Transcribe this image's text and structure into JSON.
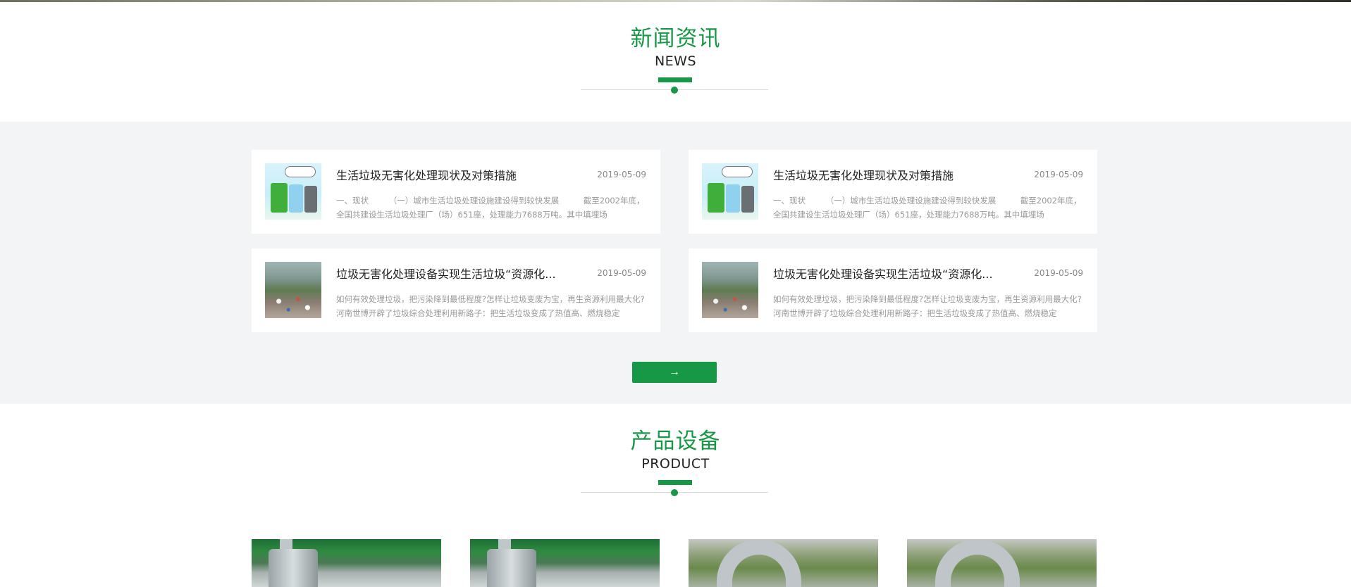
{
  "colors": {
    "accent": "#169847",
    "band_bg": "#f3f4f6"
  },
  "news_section": {
    "title_cn": "新闻资讯",
    "title_en": "NEWS",
    "items": [
      {
        "title": "生活垃圾无害化处理现状及对策措施",
        "date": "2019-05-09",
        "excerpt": "一、现状　　　（一）城市生活垃圾处理设施建设得到较快发展　　　截至2002年底，全国共建设生活垃圾处理厂（场）651座，处理能力7688万吨。其中填埋场",
        "thumb": "garbage-bins-cartoon"
      },
      {
        "title": "生活垃圾无害化处理现状及对策措施",
        "date": "2019-05-09",
        "excerpt": "一、现状　　　（一）城市生活垃圾处理设施建设得到较快发展　　　截至2002年底，全国共建设生活垃圾处理厂（场）651座，处理能力7688万吨。其中填埋场",
        "thumb": "garbage-bins-cartoon"
      },
      {
        "title": "垃圾无害化处理设备实现生活垃圾“资源化...",
        "date": "2019-05-09",
        "excerpt": "如何有效处理垃圾，把污染降到最低程度?怎样让垃圾变废为宝，再生资源利用最大化?河南世博开辟了垃圾综合处理利用新路子：把生活垃圾变成了热值高、燃烧稳定",
        "thumb": "garbage-dump-photo"
      },
      {
        "title": "垃圾无害化处理设备实现生活垃圾“资源化...",
        "date": "2019-05-09",
        "excerpt": "如何有效处理垃圾，把污染降到最低程度?怎样让垃圾变废为宝，再生资源利用最大化?河南世博开辟了垃圾综合处理利用新路子：把生活垃圾变成了热值高、燃烧稳定",
        "thumb": "garbage-dump-photo"
      }
    ],
    "more_button_label": "→"
  },
  "product_section": {
    "title_cn": "产品设备",
    "title_en": "PRODUCT",
    "items": [
      {
        "thumb": "silo-equipment-photo"
      },
      {
        "thumb": "silo-equipment-photo"
      },
      {
        "thumb": "pipe-equipment-photo"
      },
      {
        "thumb": "pipe-equipment-photo"
      }
    ]
  }
}
